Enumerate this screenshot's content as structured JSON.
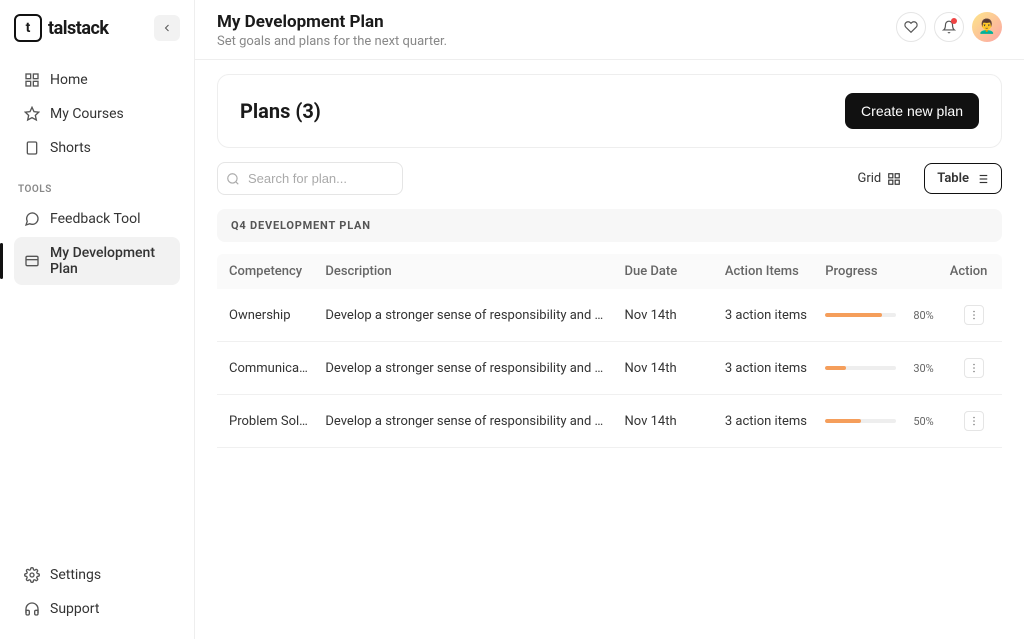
{
  "app": {
    "name": "talstack",
    "mark": "t"
  },
  "sidebar": {
    "main": [
      {
        "label": "Home"
      },
      {
        "label": "My Courses"
      },
      {
        "label": "Shorts"
      }
    ],
    "tools_label": "TOOLS",
    "tools": [
      {
        "label": "Feedback Tool"
      },
      {
        "label": "My Development Plan",
        "active": true
      }
    ],
    "bottom": [
      {
        "label": "Settings"
      },
      {
        "label": "Support"
      }
    ]
  },
  "header": {
    "title": "My Development Plan",
    "subtitle": "Set goals and plans for the next quarter."
  },
  "plans_card": {
    "title": "Plans (3)",
    "create_btn": "Create new plan"
  },
  "toolbar": {
    "search_placeholder": "Search for plan...",
    "grid_label": "Grid",
    "table_label": "Table"
  },
  "section": {
    "title": "Q4 DEVELOPMENT PLAN"
  },
  "table": {
    "columns": {
      "competency": "Competency",
      "description": "Description",
      "due": "Due Date",
      "items": "Action Items",
      "progress": "Progress",
      "action": "Action"
    },
    "rows": [
      {
        "competency": "Ownership",
        "description": "Develop a stronger sense of responsibility and accountab...",
        "due": "Nov 14th",
        "items": "3 action items",
        "pct": "80%",
        "pct_num": 80
      },
      {
        "competency": "Communication",
        "description": "Develop a stronger sense of responsibility and accountab...",
        "due": "Nov 14th",
        "items": "3 action items",
        "pct": "30%",
        "pct_num": 30
      },
      {
        "competency": "Problem Solving",
        "description": "Develop a stronger sense of responsibility and accountab...",
        "due": "Nov 14th",
        "items": "3 action items",
        "pct": "50%",
        "pct_num": 50
      }
    ]
  }
}
